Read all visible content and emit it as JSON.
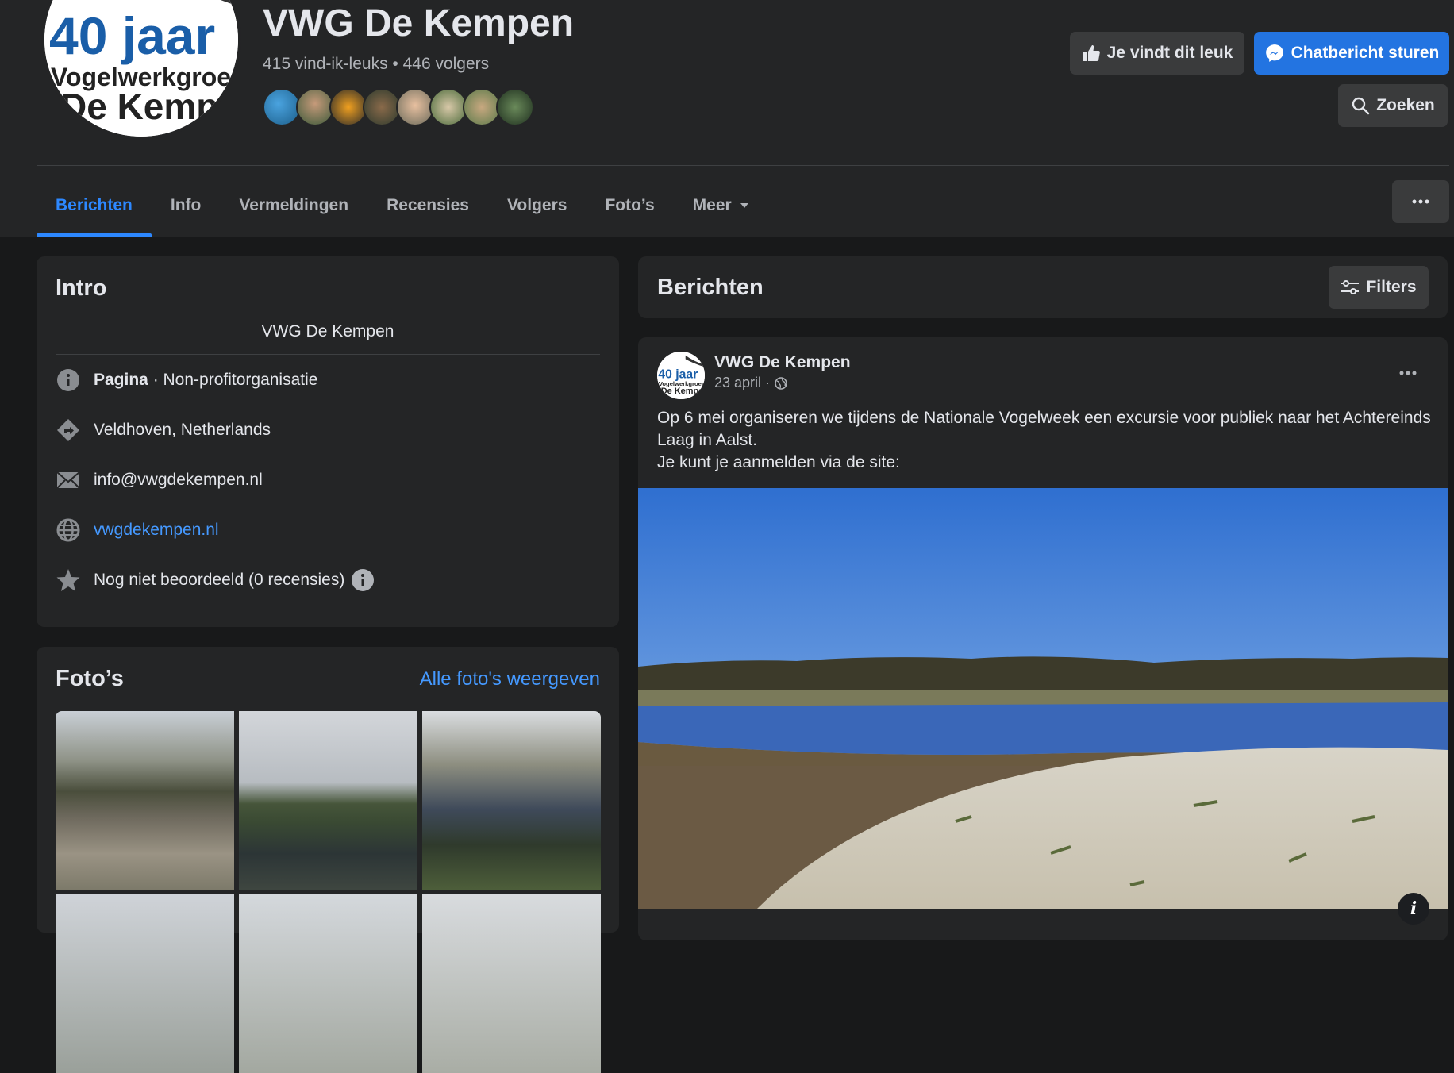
{
  "page": {
    "title": "VWG De Kempen",
    "stats": "415 vind-ik-leuks • 446 volgers",
    "logo_text_1": "40 jaar",
    "logo_text_2": "Vogelwerkgroep",
    "logo_text_3": "De Kempen"
  },
  "actions": {
    "like_label": "Je vindt dit leuk",
    "message_label": "Chatbericht sturen",
    "search_label": "Zoeken"
  },
  "nav": {
    "tabs": [
      "Berichten",
      "Info",
      "Vermeldingen",
      "Recensies",
      "Volgers",
      "Foto’s",
      "Meer"
    ],
    "more_icon": "ellipsis-icon"
  },
  "intro": {
    "title": "Intro",
    "description": "VWG De Kempen",
    "category_bold": "Pagina",
    "category_rest": " · Non-profitorganisatie",
    "location": "Veldhoven, Netherlands",
    "email": "info@vwgdekempen.nl",
    "website": "vwgdekempen.nl",
    "rating": "Nog niet beoordeeld (0 recensies)"
  },
  "photos": {
    "title": "Foto’s",
    "see_all": "Alle foto's weergeven"
  },
  "posts": {
    "title": "Berichten",
    "filters_label": "Filters"
  },
  "post": {
    "author": "VWG De Kempen",
    "date": "23 april ·",
    "line1": "Op 6 mei organiseren we tijdens de Nationale Vogelweek een excursie voor publiek naar het Achtereinds Laag in Aalst.",
    "line2": "Je kunt je aanmelden via de site:"
  },
  "colors": {
    "accent": "#2d88ff",
    "primary_button": "#2374e1",
    "surface": "#242526",
    "background": "#18191a"
  }
}
